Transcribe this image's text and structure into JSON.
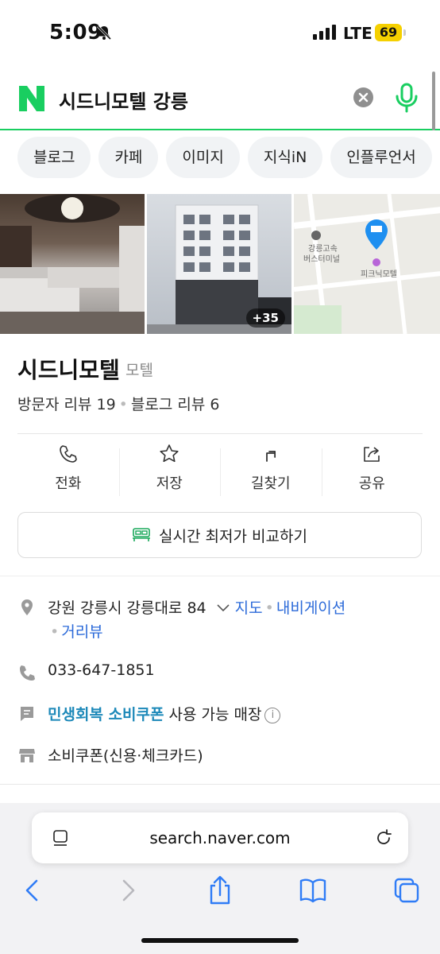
{
  "status_bar": {
    "time": "5:09",
    "network": "LTE",
    "battery": "69"
  },
  "search": {
    "query": "시드니모텔 강릉"
  },
  "tabs": [
    {
      "label": "블로그"
    },
    {
      "label": "카페"
    },
    {
      "label": "이미지"
    },
    {
      "label": "지식iN"
    },
    {
      "label": "인플루언서"
    }
  ],
  "photos": {
    "more_count": "+35",
    "map_labels": [
      "강릉고속",
      "버스터미널",
      "피크닉모텔"
    ]
  },
  "place": {
    "name": "시드니모텔",
    "category": "모텔",
    "visitor_reviews": "방문자 리뷰 19",
    "blog_reviews": "블로그 리뷰 6"
  },
  "actions": [
    {
      "label": "전화",
      "icon": "phone-icon"
    },
    {
      "label": "저장",
      "icon": "star-icon"
    },
    {
      "label": "길찾기",
      "icon": "directions-icon"
    },
    {
      "label": "공유",
      "icon": "share-icon"
    }
  ],
  "compare_button": "실시간 최저가 비교하기",
  "info": {
    "address": "강원 강릉시 강릉대로 84",
    "map_link": "지도",
    "navigation_link": "내비게이션",
    "street_view_link": "거리뷰",
    "phone": "033-647-1851",
    "coupon_highlight": "민생회복 소비쿠폰",
    "coupon_rest": "사용 가능 매장",
    "coupon_cards": "소비쿠폰(신용·체크카드)"
  },
  "browser": {
    "url": "search.naver.com"
  },
  "colors": {
    "naver_green": "#19ce60",
    "link_blue": "#2b6ad9",
    "coupon_blue": "#1d89b9"
  }
}
